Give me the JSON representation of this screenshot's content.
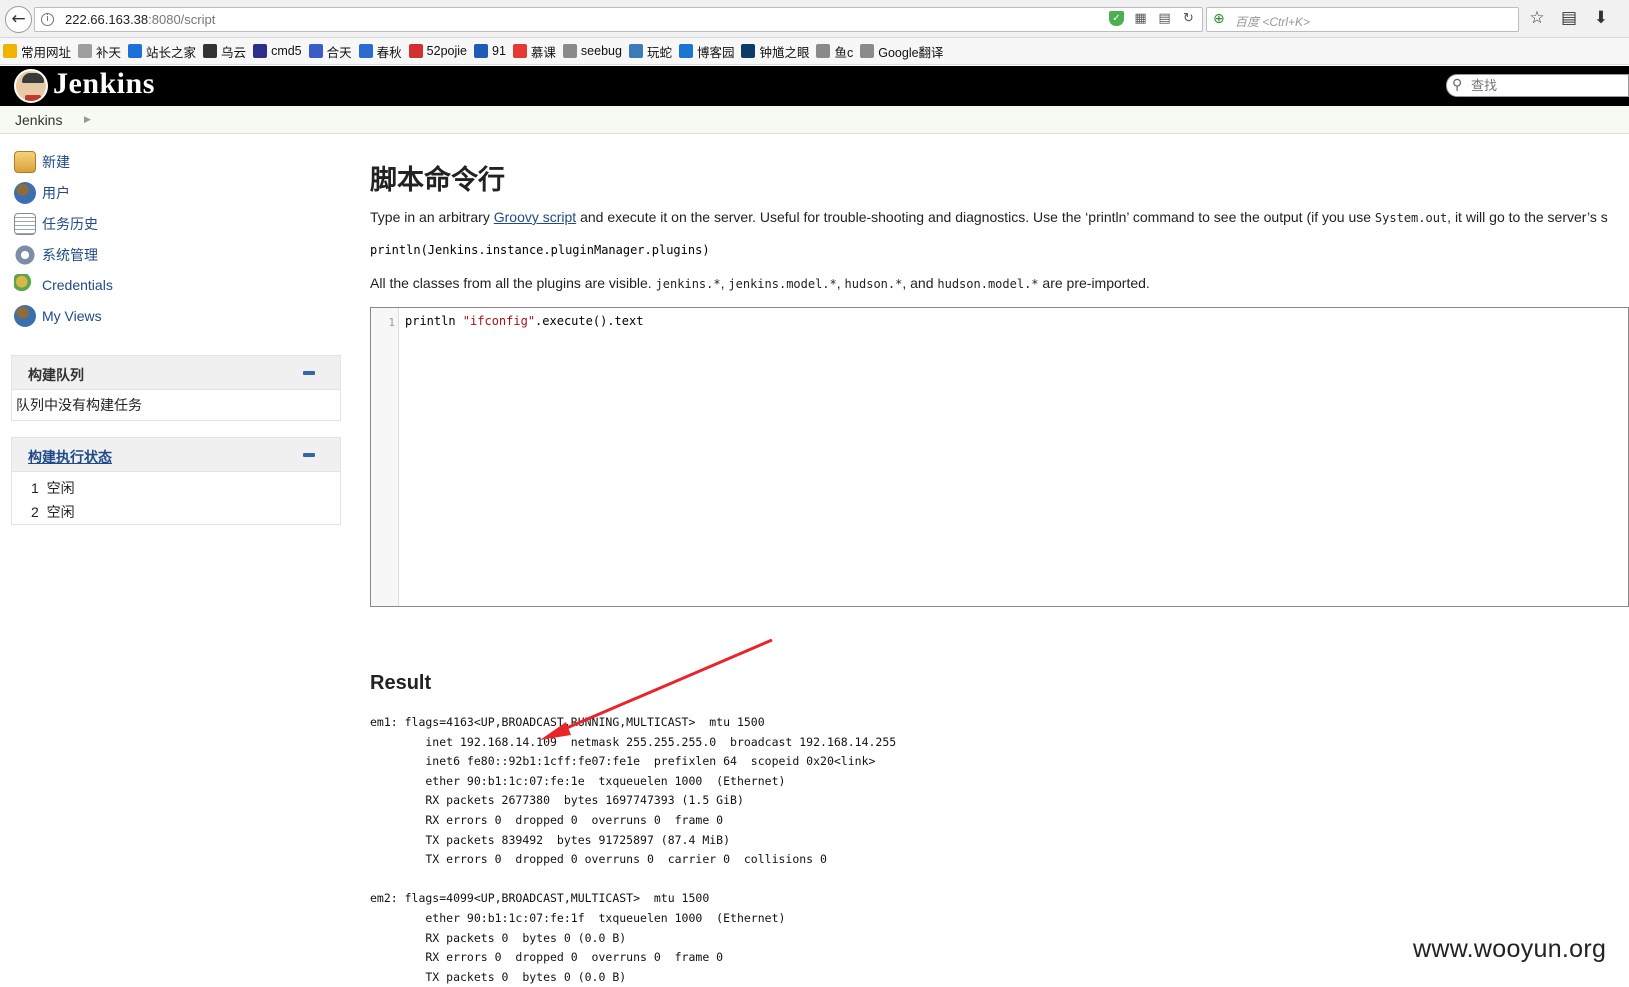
{
  "browser": {
    "url_host": "222.66.163.38",
    "url_rest": ":8080/script",
    "search_placeholder": "百度 <Ctrl+K>"
  },
  "bookmarks": [
    {
      "label": "常用网址",
      "color": "#f0b400"
    },
    {
      "label": "补天",
      "color": "#9e9e9e"
    },
    {
      "label": "站长之家",
      "color": "#1e6fd9"
    },
    {
      "label": "乌云",
      "color": "#333333"
    },
    {
      "label": "cmd5",
      "color": "#2d2d8c"
    },
    {
      "label": "合天",
      "color": "#3a5cc8"
    },
    {
      "label": "春秋",
      "color": "#2a6bd1"
    },
    {
      "label": "52pojie",
      "color": "#d32f2f"
    },
    {
      "label": "91",
      "color": "#1e5bb8"
    },
    {
      "label": "慕课",
      "color": "#e53935"
    },
    {
      "label": "seebug",
      "color": "#8a8a8a"
    },
    {
      "label": "玩蛇",
      "color": "#3d7ab8"
    },
    {
      "label": "博客园",
      "color": "#1976d2"
    },
    {
      "label": "钟馗之眼",
      "color": "#0d3b66"
    },
    {
      "label": "鱼c",
      "color": "#8a8a8a"
    },
    {
      "label": "Google翻译",
      "color": "#8a8a8a"
    }
  ],
  "jenkins": {
    "brand": "Jenkins",
    "search_placeholder": "查找",
    "breadcrumb": "Jenkins"
  },
  "sidebar": {
    "tasks": [
      {
        "label": "新建",
        "icon": "new-item-icon"
      },
      {
        "label": "用户",
        "icon": "users-icon"
      },
      {
        "label": "任务历史",
        "icon": "build-history-icon"
      },
      {
        "label": "系统管理",
        "icon": "manage-icon"
      },
      {
        "label": "Credentials",
        "icon": "credentials-icon"
      },
      {
        "label": "My Views",
        "icon": "my-views-icon"
      }
    ],
    "queue_title": "构建队列",
    "queue_empty": "队列中没有构建任务",
    "executor_title": "构建执行状态",
    "executors": [
      {
        "num": "1",
        "status": "空闲"
      },
      {
        "num": "2",
        "status": "空闲"
      }
    ]
  },
  "main": {
    "title": "脚本命令行",
    "desc_before": "Type in an arbitrary ",
    "desc_link": "Groovy script",
    "desc_after": " and execute it on the server. Useful for trouble-shooting and diagnostics. Use the ‘println’ command to see the output (if you use ",
    "desc_code": "System.out",
    "desc_tail": ", it will go to the server’s s",
    "example": "println(Jenkins.instance.pluginManager.plugins)",
    "classes_pre": "All the classes from all the plugins are visible. ",
    "classes_c1": "jenkins.*",
    "classes_s1": ", ",
    "classes_c2": "jenkins.model.*",
    "classes_s2": ", ",
    "classes_c3": "hudson.*",
    "classes_s3": ", and ",
    "classes_c4": "hudson.model.*",
    "classes_post": " are pre-imported.",
    "editor_line_no": "1",
    "editor_code_a": "println ",
    "editor_code_str": "\"ifconfig\"",
    "editor_code_b": ".execute().text",
    "result_title": "Result",
    "result_text": "em1: flags=4163<UP,BROADCAST,RUNNING,MULTICAST>  mtu 1500\n        inet 192.168.14.109  netmask 255.255.255.0  broadcast 192.168.14.255\n        inet6 fe80::92b1:1cff:fe07:fe1e  prefixlen 64  scopeid 0x20<link>\n        ether 90:b1:1c:07:fe:1e  txqueuelen 1000  (Ethernet)\n        RX packets 2677380  bytes 1697747393 (1.5 GiB)\n        RX errors 0  dropped 0  overruns 0  frame 0\n        TX packets 839492  bytes 91725897 (87.4 MiB)\n        TX errors 0  dropped 0 overruns 0  carrier 0  collisions 0\n\nem2: flags=4099<UP,BROADCAST,MULTICAST>  mtu 1500\n        ether 90:b1:1c:07:fe:1f  txqueuelen 1000  (Ethernet)\n        RX packets 0  bytes 0 (0.0 B)\n        RX errors 0  dropped 0  overruns 0  frame 0\n        TX packets 0  bytes 0 (0.0 B)"
  },
  "watermark": "www.wooyun.org",
  "colors": {
    "link": "#204a87",
    "annotation_arrow": "#e8262a"
  }
}
